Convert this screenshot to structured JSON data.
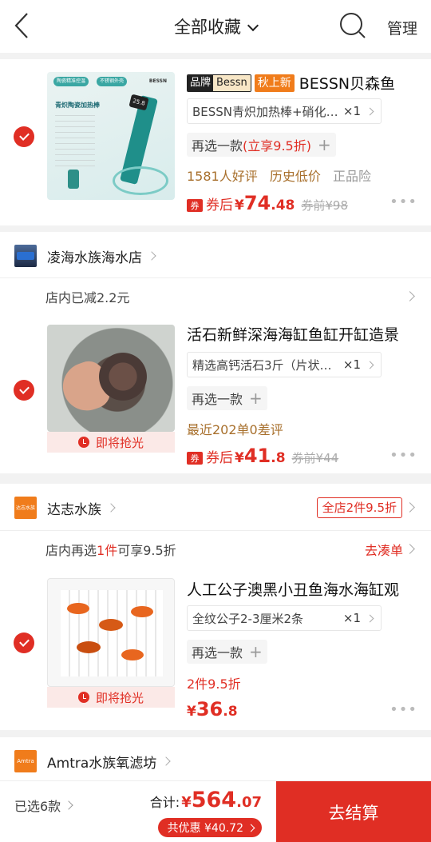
{
  "header": {
    "title": "全部收藏",
    "manage_label": "管理"
  },
  "items": [
    {
      "badge_brand": "品牌",
      "badge_brand_name": "Bessn",
      "badge_new": "秋上新",
      "title": "BESSN贝森鱼",
      "sku": "BESSN青炽加热棒+硝化…",
      "qty": "×1",
      "reselect_prefix": "再选一款",
      "reselect_hl": "(立享9.5折)",
      "reviews": "1581人好评",
      "tag_low": "历史低价",
      "tag_ins": "正品险",
      "coupon_icon": "券",
      "after_label": "券后",
      "yen": "¥",
      "price_int": "74",
      "price_dec": ".48",
      "before": "券前¥98",
      "thumb_heading": "青炽陶瓷加热棒",
      "thumb_brand": "BESSN",
      "thumb_tag1": "陶瓷精准控温",
      "thumb_tag2": "不锈钢外壳",
      "thumb_display": "25.8"
    },
    {
      "shop_name": "凌海水族海水店",
      "promo": "店内已减2.2元",
      "title": "活石新鲜深海海缸鱼缸开缸造景",
      "sku": "精选高钙活石3斤（片状…",
      "qty": "×1",
      "reselect_prefix": "再选一款",
      "meta": "最近202单0差评",
      "coupon_icon": "券",
      "after_label": "券后",
      "yen": "¥",
      "price_int": "41",
      "price_dec": ".8",
      "before": "券前¥44",
      "soon": "即将抢光"
    },
    {
      "shop_name": "达志水族",
      "shop_logo_text": "达志水族",
      "shop_tag": "全店2件9.5折",
      "promo_prefix": "店内再选",
      "promo_hl": "1件",
      "promo_suffix": "可享9.5折",
      "promo_right": "去凑单",
      "title": "人工公子澳黑小丑鱼海水海缸观",
      "sku": "全纹公子2-3厘米2条",
      "qty": "×1",
      "reselect_prefix": "再选一款",
      "meta": "2件9.5折",
      "yen": "¥",
      "price_int": "36",
      "price_dec": ".8",
      "soon": "即将抢光"
    },
    {
      "shop_name": "Amtra水族氧滤坊",
      "shop_logo_text": "Amtra"
    }
  ],
  "footer": {
    "selected": "已选6款",
    "total_label": "合计:",
    "yen": "¥",
    "total_int": "564",
    "total_dec": ".07",
    "discount": "共优惠 ¥40.72",
    "checkout": "去结算"
  },
  "colors": {
    "accent": "#e02e24",
    "muted_gold": "#a8702d",
    "badge_orange": "#f07c1b"
  }
}
